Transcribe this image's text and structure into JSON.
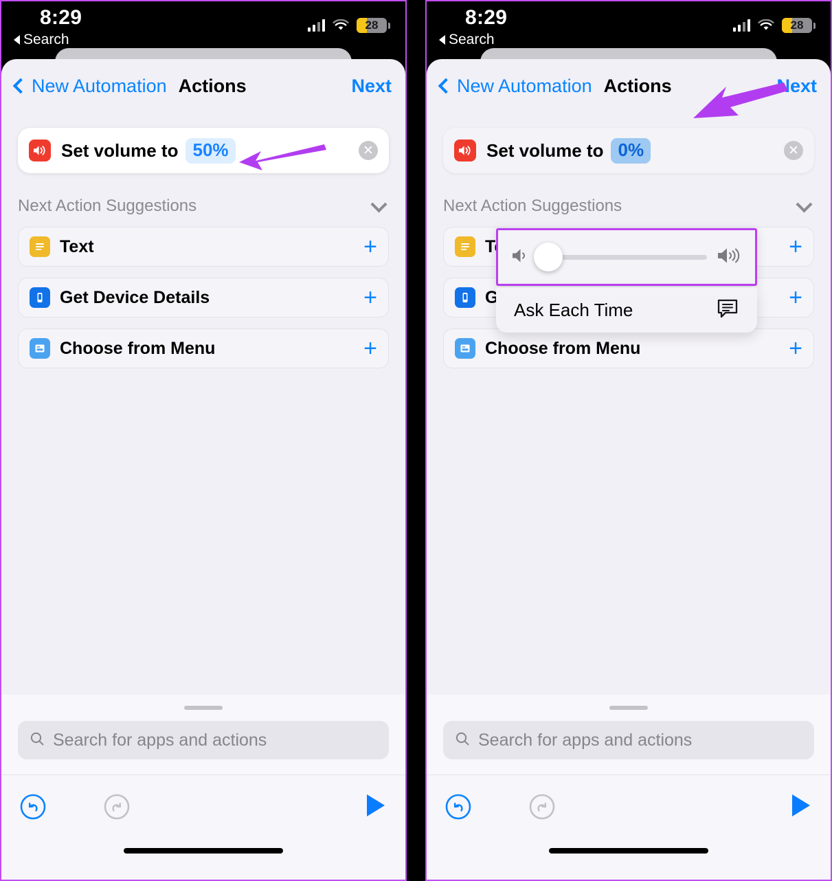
{
  "status_bar": {
    "time": "8:29",
    "back_label": "Search",
    "battery_percent": "28",
    "icons": [
      "cellular-signal-icon",
      "wifi-icon",
      "battery-icon"
    ]
  },
  "nav": {
    "back_label": "New Automation",
    "title": "Actions",
    "next_label": "Next"
  },
  "action": {
    "icon": "volume-icon",
    "label": "Set volume to",
    "value_left": "50%",
    "value_right": "0%",
    "clear_glyph": "✕"
  },
  "suggestions": {
    "header": "Next Action Suggestions",
    "collapse_icon": "chevron-down-icon",
    "items": [
      {
        "label": "Text",
        "icon": "text-icon",
        "add_glyph": "+"
      },
      {
        "label": "Get Device Details",
        "icon": "device-icon",
        "add_glyph": "+"
      },
      {
        "label": "Choose from Menu",
        "icon": "menu-icon",
        "add_glyph": "+"
      }
    ]
  },
  "popup": {
    "slider": {
      "low_icon": "speaker-low-icon",
      "high_icon": "speaker-high-icon",
      "value_percent": 0
    },
    "ask_each_time": {
      "label": "Ask Each Time",
      "icon": "ask-bubble-icon"
    }
  },
  "bottom": {
    "search_placeholder": "Search for apps and actions",
    "search_value": "",
    "search_icon": "search-icon",
    "undo_icon": "undo-icon",
    "redo_icon": "redo-icon",
    "play_icon": "play-icon"
  },
  "annotations": {
    "color": "#b23df0",
    "arrow_left_target": "value-pill-50-percent",
    "arrow_right_target": "next-button",
    "highlight_box_target": "volume-slider"
  }
}
